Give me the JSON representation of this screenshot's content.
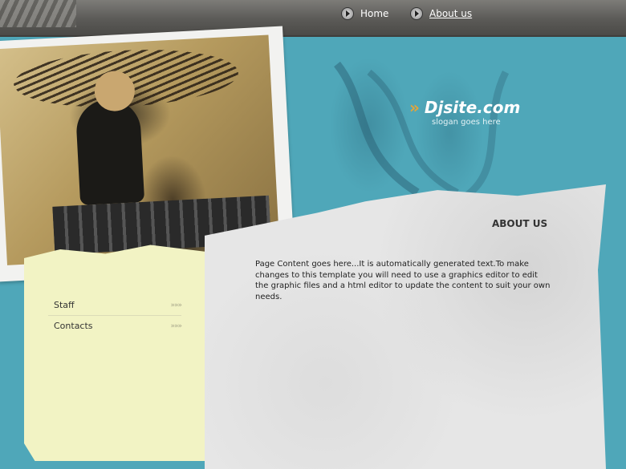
{
  "nav": {
    "items": [
      {
        "label": "Home"
      },
      {
        "label": "About us"
      }
    ]
  },
  "header": {
    "logo_text": "Djsite.com",
    "logo_glyph": "»",
    "slogan": "slogan goes here"
  },
  "sidebar": {
    "items": [
      {
        "label": "Staff",
        "arrow": "»»»"
      },
      {
        "label": "Contacts",
        "arrow": "»»»"
      }
    ]
  },
  "main": {
    "title": "ABOUT US",
    "body": "Page Content goes here...It is automatically generated text.To make changes to this template you will need to use a graphics editor to edit the graphic files and a html editor to update the content to suit your own needs."
  },
  "colors": {
    "teal_background": "#4fa7b9",
    "topbar": "#5b5a57",
    "side_paper": "#f2f3c4",
    "main_paper": "#e6e6e6",
    "logo_chevron": "#e2a53b"
  },
  "icons": [
    "play-circle-icon",
    "chevron-arrows-icon"
  ]
}
